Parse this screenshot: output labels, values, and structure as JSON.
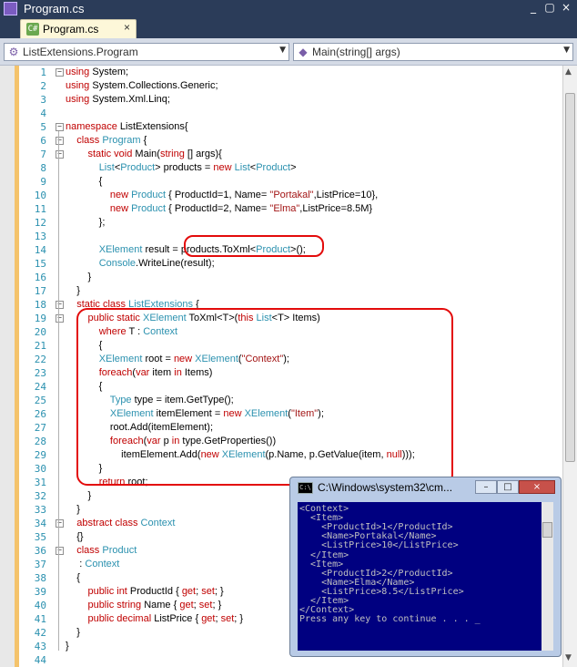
{
  "window": {
    "title": "Program.cs"
  },
  "tabs": [
    {
      "label": "Program.cs",
      "close": "×"
    }
  ],
  "navigation": {
    "class_combo": "ListExtensions.Program",
    "member_combo": "Main(string[] args)"
  },
  "editor": {
    "lines": [
      {
        "n": "1",
        "tokens": [
          [
            "kw",
            "using"
          ],
          [
            "",
            "System;"
          ]
        ]
      },
      {
        "n": "2",
        "tokens": [
          [
            "kw",
            "using"
          ],
          [
            "",
            "System.Collections.Generic;"
          ]
        ]
      },
      {
        "n": "3",
        "tokens": [
          [
            "kw",
            "using"
          ],
          [
            "",
            "System.Xml.Linq;"
          ]
        ]
      },
      {
        "n": "4",
        "tokens": []
      },
      {
        "n": "5",
        "tokens": [
          [
            "kw",
            "namespace"
          ],
          [
            "",
            "ListExtensions{"
          ]
        ]
      },
      {
        "n": "6",
        "tokens": [
          [
            "",
            "    "
          ],
          [
            "kw",
            "class"
          ],
          [
            "ty",
            "Program"
          ],
          [
            "",
            "{"
          ]
        ]
      },
      {
        "n": "7",
        "tokens": [
          [
            "",
            "        "
          ],
          [
            "kw",
            "static void"
          ],
          [
            "",
            "Main("
          ],
          [
            "kw",
            "string"
          ],
          [
            "",
            "[] args){"
          ]
        ]
      },
      {
        "n": "8",
        "tokens": [
          [
            "",
            "            "
          ],
          [
            "ty",
            "List"
          ],
          [
            "",
            "<"
          ],
          [
            "ty",
            "Product"
          ],
          [
            "",
            "> products = "
          ],
          [
            "kw",
            "new"
          ],
          [
            "ty",
            "List"
          ],
          [
            "",
            "<"
          ],
          [
            "ty",
            "Product"
          ],
          [
            "",
            ">"
          ]
        ]
      },
      {
        "n": "9",
        "tokens": [
          [
            "",
            "            {"
          ]
        ]
      },
      {
        "n": "10",
        "tokens": [
          [
            "",
            "                "
          ],
          [
            "kw",
            "new"
          ],
          [
            "ty",
            "Product"
          ],
          [
            "",
            "{ ProductId=1, Name="
          ],
          [
            "st",
            "\"Portakal\""
          ],
          [
            "",
            ",ListPrice=10},"
          ]
        ]
      },
      {
        "n": "11",
        "tokens": [
          [
            "",
            "                "
          ],
          [
            "kw",
            "new"
          ],
          [
            "ty",
            "Product"
          ],
          [
            "",
            "{ ProductId=2, Name="
          ],
          [
            "st",
            "\"Elma\""
          ],
          [
            "",
            ",ListPrice=8.5M}"
          ]
        ]
      },
      {
        "n": "12",
        "tokens": [
          [
            "",
            "            };"
          ]
        ]
      },
      {
        "n": "13",
        "tokens": []
      },
      {
        "n": "14",
        "tokens": [
          [
            "",
            "            "
          ],
          [
            "ty",
            "XElement"
          ],
          [
            "",
            "result = products.ToXml<"
          ],
          [
            "ty",
            "Product"
          ],
          [
            "",
            ">();"
          ]
        ]
      },
      {
        "n": "15",
        "tokens": [
          [
            "",
            "            "
          ],
          [
            "ty",
            "Console"
          ],
          [
            "",
            ".WriteLine(result);"
          ]
        ]
      },
      {
        "n": "16",
        "tokens": [
          [
            "",
            "        }"
          ]
        ]
      },
      {
        "n": "17",
        "tokens": [
          [
            "",
            "    }"
          ]
        ]
      },
      {
        "n": "18",
        "tokens": [
          [
            "",
            "    "
          ],
          [
            "kw",
            "static class"
          ],
          [
            "ty",
            "ListExtensions"
          ],
          [
            "",
            "{"
          ]
        ]
      },
      {
        "n": "19",
        "tokens": [
          [
            "",
            "        "
          ],
          [
            "kw",
            "public static"
          ],
          [
            "ty",
            "XElement"
          ],
          [
            "",
            "ToXml<T>("
          ],
          [
            "kw",
            "this"
          ],
          [
            "ty",
            "List"
          ],
          [
            "",
            "<T> Items)"
          ]
        ]
      },
      {
        "n": "20",
        "tokens": [
          [
            "",
            "            "
          ],
          [
            "kw",
            "where"
          ],
          [
            "",
            "T : "
          ],
          [
            "ty",
            "Context"
          ]
        ]
      },
      {
        "n": "21",
        "tokens": [
          [
            "",
            "            {"
          ]
        ]
      },
      {
        "n": "22",
        "tokens": [
          [
            "",
            "            "
          ],
          [
            "ty",
            "XElement"
          ],
          [
            "",
            "root = "
          ],
          [
            "kw",
            "new"
          ],
          [
            "ty",
            "XElement"
          ],
          [
            "",
            "("
          ],
          [
            "st",
            "\"Context\""
          ],
          [
            "",
            ");"
          ]
        ]
      },
      {
        "n": "23",
        "tokens": [
          [
            "",
            "            "
          ],
          [
            "kw",
            "foreach"
          ],
          [
            "",
            "("
          ],
          [
            "kw",
            "var"
          ],
          [
            "",
            "item "
          ],
          [
            "kw",
            "in"
          ],
          [
            "",
            "Items)"
          ]
        ]
      },
      {
        "n": "24",
        "tokens": [
          [
            "",
            "            {"
          ]
        ]
      },
      {
        "n": "25",
        "tokens": [
          [
            "",
            "                "
          ],
          [
            "ty",
            "Type"
          ],
          [
            "",
            "type = item.GetType();"
          ]
        ]
      },
      {
        "n": "26",
        "tokens": [
          [
            "",
            "                "
          ],
          [
            "ty",
            "XElement"
          ],
          [
            "",
            "itemElement = "
          ],
          [
            "kw",
            "new"
          ],
          [
            "ty",
            "XElement"
          ],
          [
            "",
            "("
          ],
          [
            "st",
            "\"Item\""
          ],
          [
            "",
            ");"
          ]
        ]
      },
      {
        "n": "27",
        "tokens": [
          [
            "",
            "                root.Add(itemElement);"
          ]
        ]
      },
      {
        "n": "28",
        "tokens": [
          [
            "",
            "                "
          ],
          [
            "kw",
            "foreach"
          ],
          [
            "",
            "("
          ],
          [
            "kw",
            "var"
          ],
          [
            "",
            "p "
          ],
          [
            "kw",
            "in"
          ],
          [
            "",
            "type.GetProperties())"
          ]
        ]
      },
      {
        "n": "29",
        "tokens": [
          [
            "",
            "                    itemElement.Add("
          ],
          [
            "kw",
            "new"
          ],
          [
            "ty",
            "XElement"
          ],
          [
            "",
            "(p.Name, p.GetValue(item, "
          ],
          [
            "kw",
            "null"
          ],
          [
            "",
            ")));"
          ]
        ]
      },
      {
        "n": "30",
        "tokens": [
          [
            "",
            "            }"
          ]
        ]
      },
      {
        "n": "31",
        "tokens": [
          [
            "",
            "            "
          ],
          [
            "kw",
            "return"
          ],
          [
            "",
            "root;"
          ]
        ]
      },
      {
        "n": "32",
        "tokens": [
          [
            "",
            "        }"
          ]
        ]
      },
      {
        "n": "33",
        "tokens": [
          [
            "",
            "    }"
          ]
        ]
      },
      {
        "n": "34",
        "tokens": [
          [
            "",
            "    "
          ],
          [
            "kw",
            "abstract class"
          ],
          [
            "ty",
            "Context"
          ]
        ]
      },
      {
        "n": "35",
        "tokens": [
          [
            "",
            "    {}"
          ]
        ]
      },
      {
        "n": "36",
        "tokens": [
          [
            "",
            "    "
          ],
          [
            "kw",
            "class"
          ],
          [
            "ty",
            "Product"
          ]
        ]
      },
      {
        "n": "37",
        "tokens": [
          [
            "",
            "     :"
          ],
          [
            "ty",
            "Context"
          ]
        ]
      },
      {
        "n": "38",
        "tokens": [
          [
            "",
            "    {"
          ]
        ]
      },
      {
        "n": "39",
        "tokens": [
          [
            "",
            "        "
          ],
          [
            "kw",
            "public int"
          ],
          [
            "",
            "ProductId { "
          ],
          [
            "kw",
            "get"
          ],
          [
            "",
            "; "
          ],
          [
            "kw",
            "set"
          ],
          [
            "",
            "; }"
          ]
        ]
      },
      {
        "n": "40",
        "tokens": [
          [
            "",
            "        "
          ],
          [
            "kw",
            "public string"
          ],
          [
            "",
            "Name { "
          ],
          [
            "kw",
            "get"
          ],
          [
            "",
            "; "
          ],
          [
            "kw",
            "set"
          ],
          [
            "",
            "; }"
          ]
        ]
      },
      {
        "n": "41",
        "tokens": [
          [
            "",
            "        "
          ],
          [
            "kw",
            "public decimal"
          ],
          [
            "",
            "ListPrice { "
          ],
          [
            "kw",
            "get"
          ],
          [
            "",
            "; "
          ],
          [
            "kw",
            "set"
          ],
          [
            "",
            "; }"
          ]
        ]
      },
      {
        "n": "42",
        "tokens": [
          [
            "",
            "    }"
          ]
        ]
      },
      {
        "n": "43",
        "tokens": [
          [
            "",
            "}"
          ]
        ]
      },
      {
        "n": "44",
        "tokens": []
      }
    ]
  },
  "console": {
    "title": "C:\\Windows\\system32\\cm...",
    "icon_text": "C:\\",
    "lines": [
      "<Context>",
      "  <Item>",
      "    <ProductId>1</ProductId>",
      "    <Name>Portakal</Name>",
      "    <ListPrice>10</ListPrice>",
      "  </Item>",
      "  <Item>",
      "    <ProductId>2</ProductId>",
      "    <Name>Elma</Name>",
      "    <ListPrice>8.5</ListPrice>",
      "  </Item>",
      "</Context>",
      "Press any key to continue . . . _"
    ]
  },
  "colors": {
    "keyword": "#c00000",
    "type": "#2b91af",
    "string": "#a31515",
    "linenumber": "#2b91af",
    "highlight": "#e30b0b"
  },
  "icons": {
    "app": "visual-studio-icon",
    "file": "csharp-file-icon",
    "class": "class-icon",
    "method": "method-icon",
    "console": "console-icon"
  }
}
